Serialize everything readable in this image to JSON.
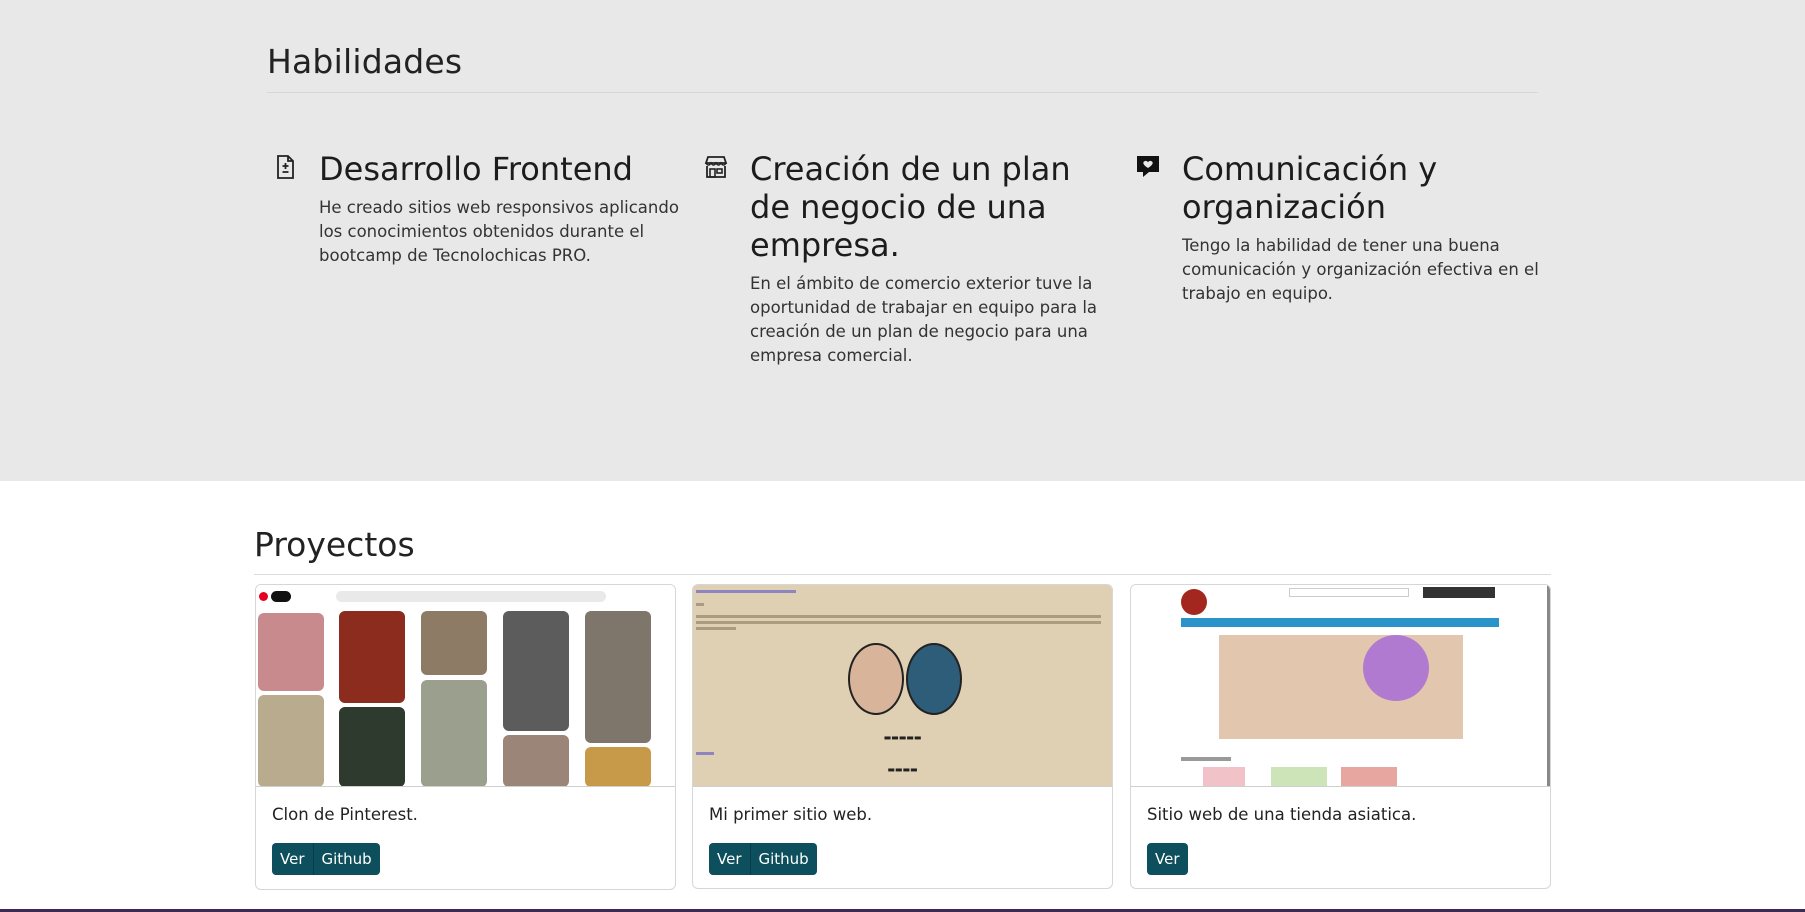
{
  "skills": {
    "title": "Habilidades",
    "items": [
      {
        "icon": "file-plus-icon",
        "title": "Desarrollo Frontend",
        "text_lines": [
          "He creado sitios web responsivos aplicando",
          "los conocimientos obtenidos durante el",
          "bootcamp de Tecnolochicas PRO."
        ]
      },
      {
        "icon": "shop-icon",
        "title_lines": [
          "Creación de un plan",
          "de negocio de una",
          "empresa."
        ],
        "text_lines": [
          "En el ámbito de comercio exterior tuve la",
          "oportunidad de trabajar en equipo para la",
          "creación de un plan de negocio para una",
          "empresa comercial."
        ]
      },
      {
        "icon": "chat-heart-icon",
        "title_lines": [
          "Comunicación y",
          "organización"
        ],
        "text_lines": [
          "Tengo la habilidad de tener una buena",
          "comunicación y organización efectiva en el",
          "trabajo en equipo."
        ]
      }
    ]
  },
  "projects": {
    "title": "Proyectos",
    "cards": [
      {
        "text": "Clon de Pinterest.",
        "buttons": [
          "Ver",
          "Github"
        ]
      },
      {
        "text": "Mi primer sitio web.",
        "buttons": [
          "Ver",
          "Github"
        ]
      },
      {
        "text": "Sitio web de una tienda asiatica.",
        "buttons": [
          "Ver"
        ]
      }
    ]
  },
  "colors": {
    "skills_bg": "#e8e8e8",
    "button_bg": "#0d4f5c",
    "page_bg": "#ffffff"
  }
}
